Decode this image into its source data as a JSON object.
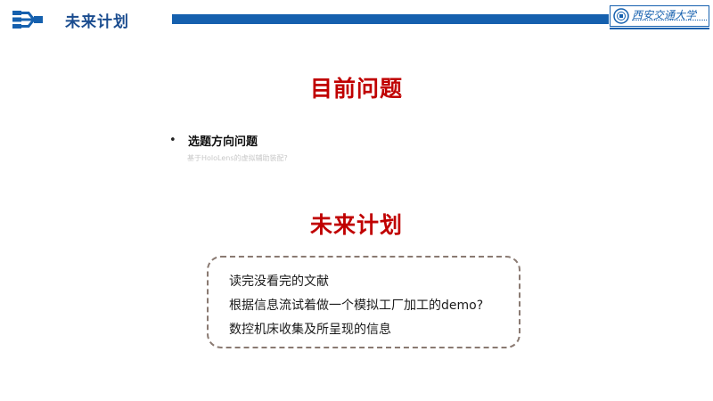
{
  "header": {
    "title": "未来计划",
    "university_logo_text": "西安交通大学",
    "icon": "branch-arrows-icon",
    "accent_color": "#1560ae"
  },
  "problems": {
    "heading": "目前问题",
    "bullet": "选题方向问题",
    "note": "基于HoloLens的虚拟辅助装配?"
  },
  "plan": {
    "heading": "未来计划",
    "items": [
      "读完没看完的文献",
      "根据信息流试着做一个模拟工厂加工的demo?",
      "数控机床收集及所呈现的信息"
    ]
  },
  "colors": {
    "heading_red": "#c00000",
    "box_border": "#8a7a72"
  }
}
